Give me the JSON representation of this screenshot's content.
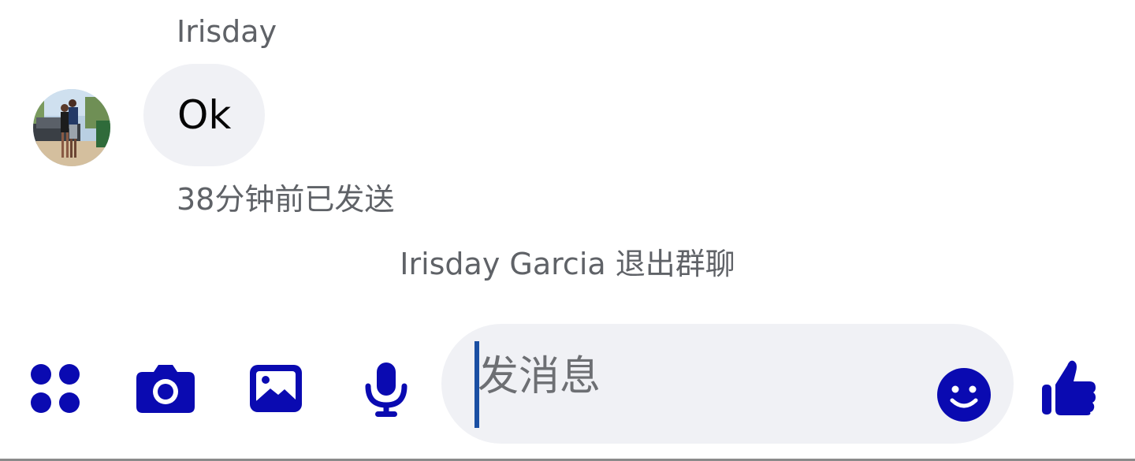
{
  "conversation": {
    "sender_name": "Irisday",
    "message_text": "Ok",
    "sent_status": "38分钟前已发送",
    "system_message": "Irisday Garcia 退出群聊"
  },
  "composer": {
    "placeholder": "发消息",
    "icons": {
      "more": "four-dots-icon",
      "camera": "camera-icon",
      "gallery": "image-icon",
      "voice": "microphone-icon",
      "emoji": "emoji-icon",
      "like": "thumbs-up-icon"
    }
  },
  "colors": {
    "accent": "#0a0ab1",
    "bubble_bg": "#f0f1f5",
    "secondary_text": "#5f6267",
    "caret": "#1a4fa3"
  }
}
